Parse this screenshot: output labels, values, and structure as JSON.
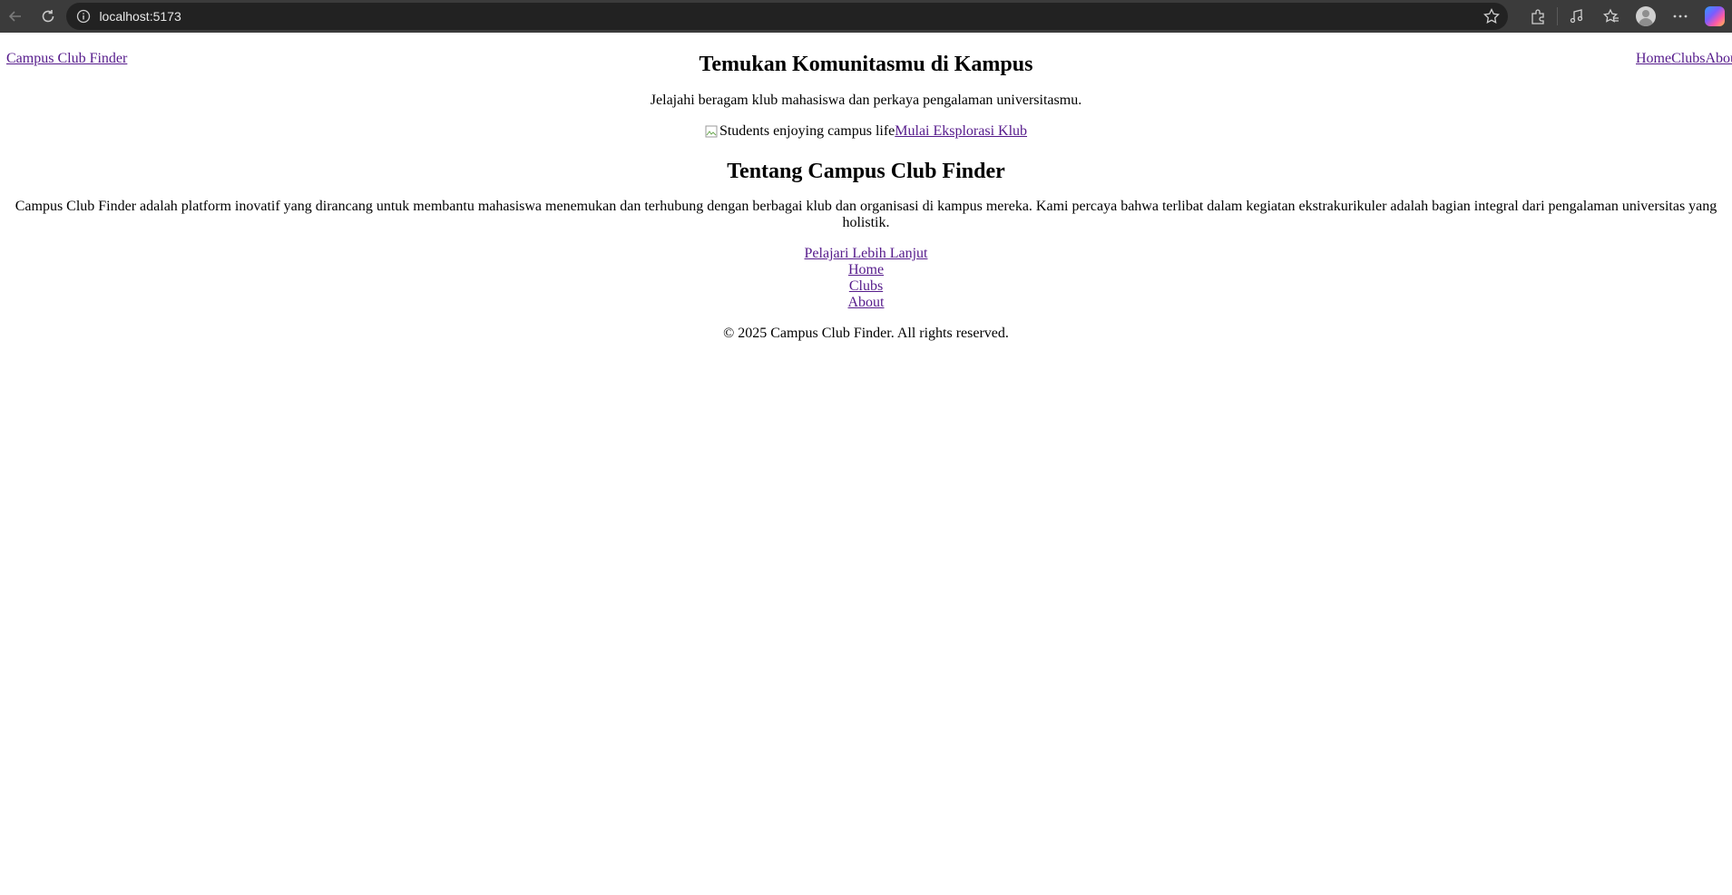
{
  "browser": {
    "url": "localhost:5173",
    "icons": [
      "back-arrow-icon",
      "reload-icon",
      "site-info-icon",
      "favorite-star-icon",
      "extensions-icon",
      "media-icon",
      "favorites-icon",
      "profile-avatar-icon",
      "more-menu-icon",
      "copilot-icon"
    ]
  },
  "header": {
    "brand": "Campus Club Finder",
    "nav": [
      "Home",
      "Clubs",
      "Abou"
    ]
  },
  "hero": {
    "title": "Temukan Komunitasmu di Kampus",
    "subtitle": "Jelajahi beragam klub mahasiswa dan perkaya pengalaman universitasmu.",
    "image_alt": "Students enjoying campus life",
    "cta": "Mulai Eksplorasi Klub"
  },
  "about": {
    "title": "Tentang Campus Club Finder",
    "text": "Campus Club Finder adalah platform inovatif yang dirancang untuk membantu mahasiswa menemukan dan terhubung dengan berbagai klub dan organisasi di kampus mereka. Kami percaya bahwa terlibat dalam kegiatan ekstrakurikuler adalah bagian integral dari pengalaman universitas yang holistik.",
    "learn_more": "Pelajari Lebih Lanjut"
  },
  "footer": {
    "nav": [
      "Home",
      "Clubs",
      "About"
    ],
    "copyright": "© 2025 Campus Club Finder. All rights reserved."
  },
  "colors": {
    "link": "#551a8b",
    "chrome_bg": "#3b3b3b",
    "omnibox_bg": "#222222"
  }
}
